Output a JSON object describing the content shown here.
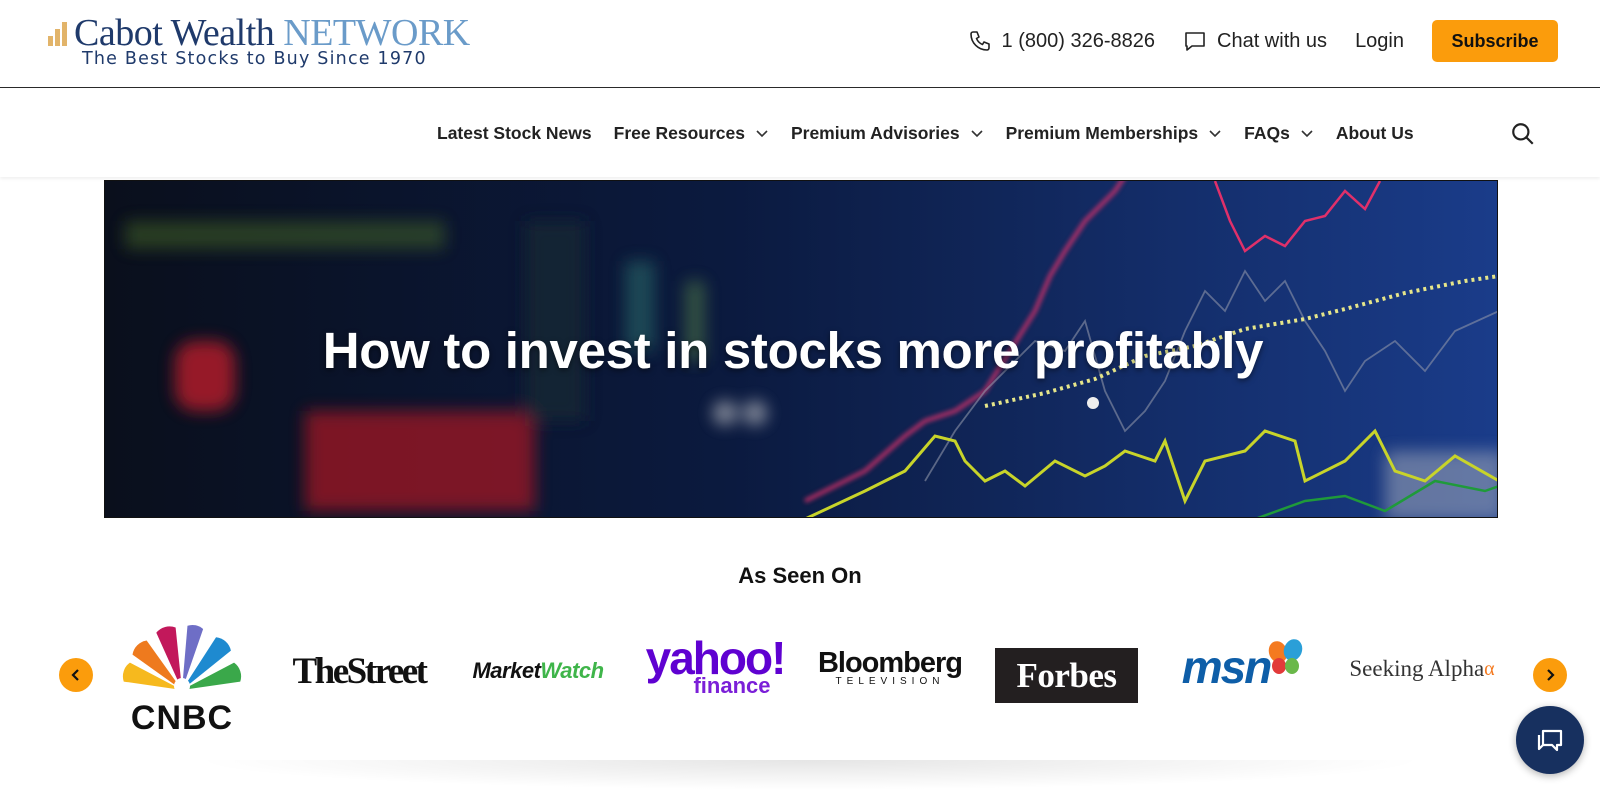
{
  "logo": {
    "name_main": "Cabot Wealth",
    "name_accent": "NETWORK",
    "tagline": "The Best Stocks to Buy Since 1970"
  },
  "header": {
    "phone": "1 (800) 326-8826",
    "chat_label": "Chat with us",
    "login_label": "Login",
    "subscribe_label": "Subscribe"
  },
  "nav": {
    "items": [
      {
        "label": "Latest Stock News",
        "has_dropdown": false
      },
      {
        "label": "Free Resources",
        "has_dropdown": true
      },
      {
        "label": "Premium Advisories",
        "has_dropdown": true
      },
      {
        "label": "Premium Memberships",
        "has_dropdown": true
      },
      {
        "label": "FAQs",
        "has_dropdown": true
      },
      {
        "label": "About Us",
        "has_dropdown": false
      }
    ],
    "search_icon": "search-icon"
  },
  "hero": {
    "title": "How to invest in stocks more profitably"
  },
  "seen_on": {
    "title": "As Seen On",
    "brands": {
      "cnbc": "CNBC",
      "thestreet": "TheStreet",
      "marketwatch_a": "Market",
      "marketwatch_b": "Watch",
      "yahoo_a": "yahoo!",
      "yahoo_b": "finance",
      "bloomberg_a": "Bloomberg",
      "bloomberg_b": "TELEVISION",
      "forbes": "Forbes",
      "msn": "msn",
      "seeking": "Seeking Alpha",
      "seeking_alpha_symbol": "α"
    }
  },
  "colors": {
    "accent": "#fb9c0c",
    "navy": "#17305f",
    "logo_blue": "#1f3a6b",
    "logo_light_blue": "#6a9bc9"
  }
}
